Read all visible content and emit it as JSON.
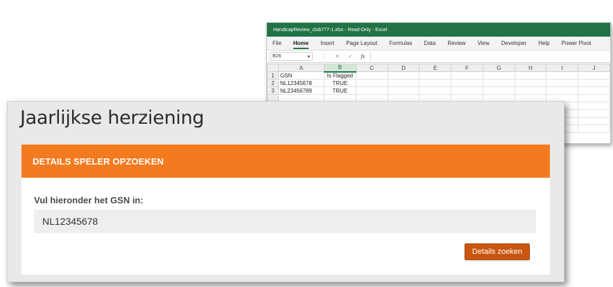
{
  "excel": {
    "title": "HandicapReview_club777-1.xlsx  -  Read-Only  -  Excel",
    "menu": [
      "File",
      "Home",
      "Insert",
      "Page Layout",
      "Formulas",
      "Data",
      "Review",
      "View",
      "Developer",
      "Help",
      "Power Pivot"
    ],
    "active_menu": "Home",
    "name_box": "B26",
    "columns": [
      "A",
      "B",
      "C",
      "D",
      "E",
      "F",
      "G",
      "H",
      "I",
      "J"
    ],
    "rows": [
      {
        "num": "1",
        "a": "GSN",
        "b": "Is Flagged"
      },
      {
        "num": "2",
        "a": "NL12345678",
        "b": "TRUE"
      },
      {
        "num": "3",
        "a": "NL23456789",
        "b": "TRUE"
      }
    ]
  },
  "web": {
    "page_title": "Jaarlijkse herziening",
    "section_header": "DETAILS SPELER OPZOEKEN",
    "field_label": "Vul hieronder het GSN in:",
    "gsn_value": "NL12345678",
    "button_label": "Details zoeken",
    "colors": {
      "accent": "#f47a1f",
      "button": "#c9560f",
      "excel_green": "#217346"
    }
  }
}
